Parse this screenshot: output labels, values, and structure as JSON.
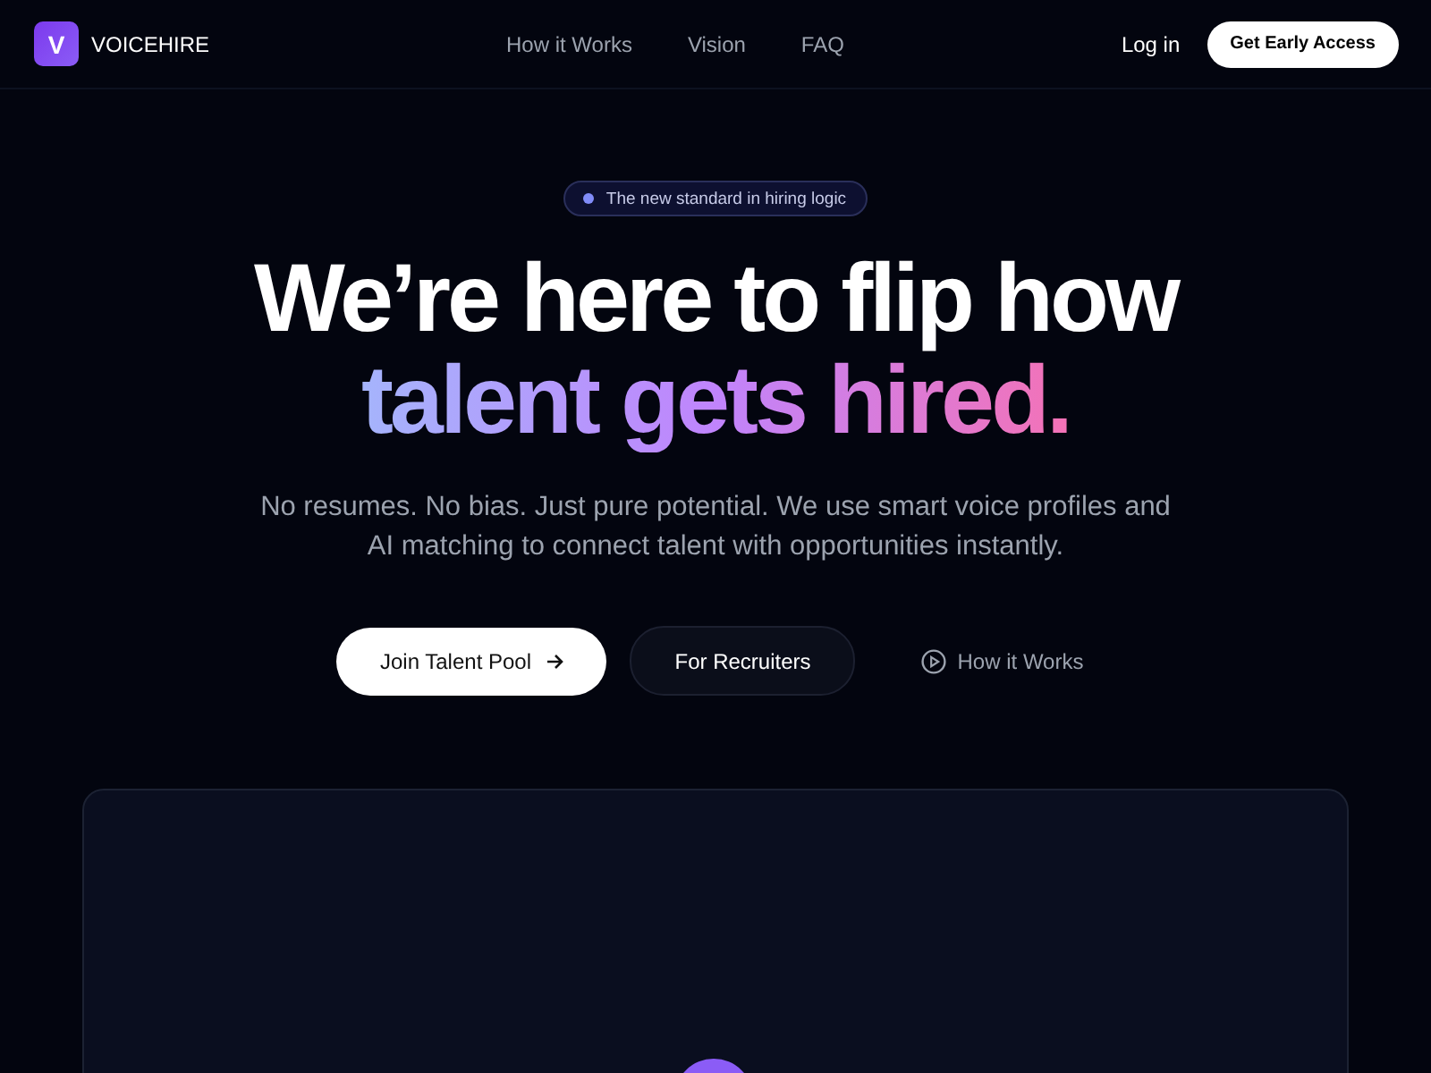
{
  "header": {
    "logo": {
      "letter": "V",
      "name": "VOICEHIRE"
    },
    "nav": [
      "How it Works",
      "Vision",
      "FAQ"
    ],
    "login": "Log in",
    "cta": "Get Early Access"
  },
  "hero": {
    "badge": "The new standard in hiring logic",
    "headline_line_1": "We’re here to flip how",
    "headline_line_2": "talent gets hired.",
    "subtitle": "No resumes. No bias. Just pure potential. We use smart voice profiles and AI matching to connect talent with opportunities instantly.",
    "buttons": [
      {
        "kind": "primary",
        "label": "Join Talent Pool"
      },
      {
        "kind": "secondary",
        "label": "For Recruiters"
      },
      {
        "kind": "link",
        "label": "How it Works"
      }
    ]
  }
}
